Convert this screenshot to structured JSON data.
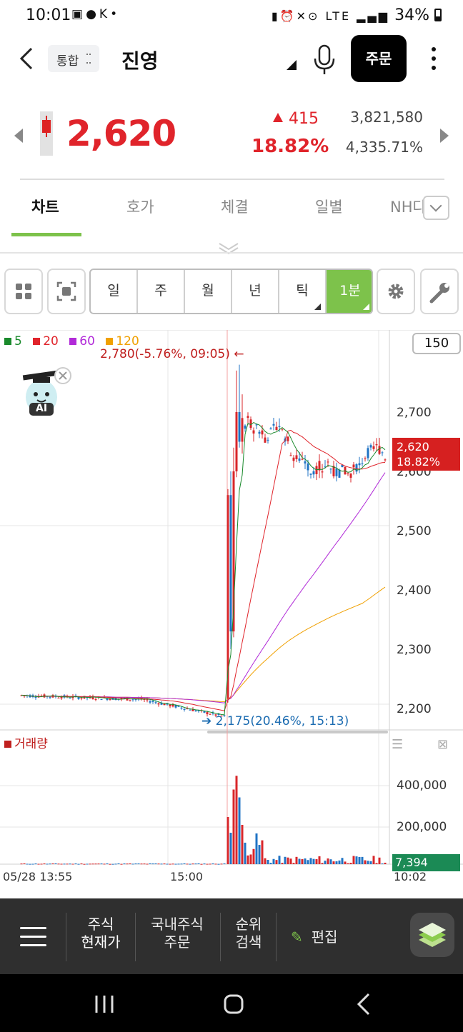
{
  "status_bar": {
    "time": "10:01",
    "icons": [
      "gallery-icon",
      "talk-icon",
      "k2-icon",
      "dot-icon"
    ],
    "right_icons": [
      "battery-saver-icon",
      "alarm-icon",
      "mute-icon",
      "hotspot-icon",
      "lte-icon",
      "signal-icon"
    ],
    "battery": "34%"
  },
  "header": {
    "scope_label": "통합",
    "stock_name": "진영",
    "order_label": "주문"
  },
  "quote": {
    "price": "2,620",
    "change": "415",
    "change_pct": "18.82%",
    "volume": "3,821,580",
    "volume_pct": "4,335.71%",
    "color_up": "#e0242b"
  },
  "tabs": [
    {
      "label": "차트",
      "active": true
    },
    {
      "label": "호가"
    },
    {
      "label": "체결"
    },
    {
      "label": "일별"
    },
    {
      "label": "NH다"
    }
  ],
  "periods": {
    "items": [
      "일",
      "주",
      "월",
      "년",
      "틱",
      "1분"
    ],
    "selected": "1분"
  },
  "chart": {
    "legend": [
      {
        "label": "5",
        "color": "#1a8a2c"
      },
      {
        "label": "20",
        "color": "#e0242b"
      },
      {
        "label": "60",
        "color": "#b12ad8"
      },
      {
        "label": "120",
        "color": "#f0a000"
      }
    ],
    "zoom": "150",
    "high_annotation": "2,780(-5.76%, 09:05)",
    "low_annotation": "2,175(20.46%, 15:13)",
    "ai_label": "AI",
    "current_price": "2,620",
    "current_pct": "18.82%",
    "volume_label": "거래량",
    "volume_current": "7,394",
    "x_labels": [
      "05/28 13:55",
      "15:00",
      "10:02"
    ]
  },
  "chart_data": {
    "type": "candlestick",
    "price_axis": {
      "ticks": [
        "2,200",
        "2,300",
        "2,400",
        "2,500",
        "2,600",
        "2,700"
      ],
      "range": [
        2160,
        2870
      ]
    },
    "volume_axis": {
      "ticks": [
        "200,000",
        "400,000"
      ],
      "range": [
        0,
        580000
      ]
    },
    "high": 2780,
    "low": 2175,
    "last": 2620,
    "volume_bars_approx": [
      {
        "x": "first spike",
        "value": 240000
      },
      {
        "x": "peak",
        "value": 450000
      },
      {
        "x": "second",
        "value": 340000
      }
    ]
  },
  "bottom_nav": {
    "items": [
      {
        "label1": "주식",
        "label2": "현재가"
      },
      {
        "label1": "국내주식",
        "label2": "주문"
      },
      {
        "label1": "순위",
        "label2": "검색"
      }
    ],
    "edit_label": "편집"
  }
}
